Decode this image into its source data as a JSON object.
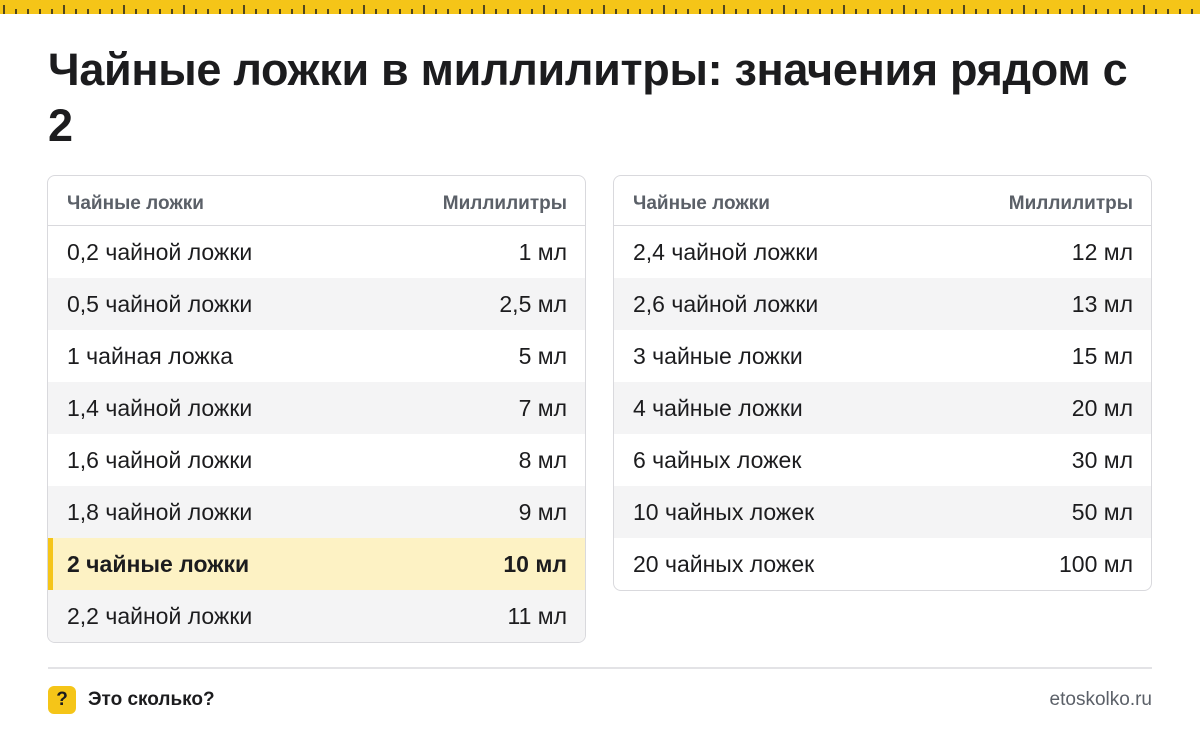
{
  "title": "Чайные ложки в миллилитры: значения рядом с 2",
  "colors": {
    "accent": "#f5c518",
    "highlight_bg": "#fdf2c4",
    "stripe": "#f4f4f5"
  },
  "tables": {
    "left": {
      "headers": [
        "Чайные ложки",
        "Миллилитры"
      ],
      "rows": [
        [
          "0,2 чайной ложки",
          "1 мл"
        ],
        [
          "0,5 чайной ложки",
          "2,5 мл"
        ],
        [
          "1 чайная ложка",
          "5 мл"
        ],
        [
          "1,4 чайной ложки",
          "7 мл"
        ],
        [
          "1,6 чайной ложки",
          "8 мл"
        ],
        [
          "1,8 чайной ложки",
          "9 мл"
        ],
        [
          "2 чайные ложки",
          "10 мл"
        ],
        [
          "2,2 чайной ложки",
          "11 мл"
        ]
      ],
      "highlighted_row": 6
    },
    "right": {
      "headers": [
        "Чайные ложки",
        "Миллилитры"
      ],
      "rows": [
        [
          "2,4 чайной ложки",
          "12 мл"
        ],
        [
          "2,6 чайной ложки",
          "13 мл"
        ],
        [
          "3 чайные ложки",
          "15 мл"
        ],
        [
          "4 чайные ложки",
          "20 мл"
        ],
        [
          "6 чайных ложек",
          "30 мл"
        ],
        [
          "10 чайных ложек",
          "50 мл"
        ],
        [
          "20 чайных ложек",
          "100 мл"
        ]
      ]
    }
  },
  "footer": {
    "logo_icon": "question-mark-icon",
    "logo_glyph": "?",
    "brand": "Это сколько?",
    "site": "etoskolko.ru"
  }
}
